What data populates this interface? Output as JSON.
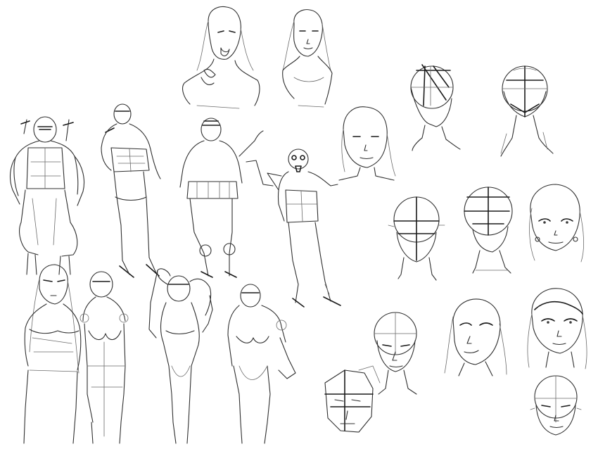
{
  "sheet": {
    "background": "#ffffff",
    "stroke_color": "#2f2f2f"
  }
}
